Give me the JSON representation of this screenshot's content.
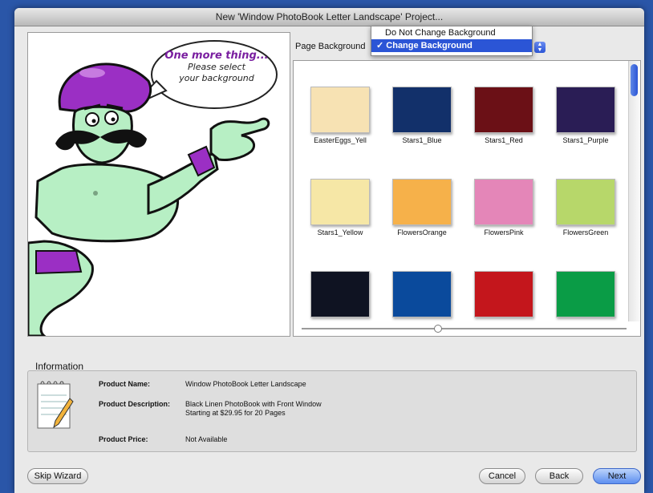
{
  "window": {
    "title": "New 'Window PhotoBook Letter Landscape' Project..."
  },
  "bubble": {
    "title": "One more thing...",
    "line1": "Please select",
    "line2": "your background"
  },
  "page_background": {
    "label": "Page Background",
    "options": [
      "Do Not Change Background",
      "Change Background"
    ],
    "selected": "Change Background",
    "check": "✓"
  },
  "backgrounds": [
    {
      "label": "EasterEggs_Yell",
      "color": "#f7e2b3"
    },
    {
      "label": "Stars1_Blue",
      "color": "#12306a"
    },
    {
      "label": "Stars1_Red",
      "color": "#6b1016"
    },
    {
      "label": "Stars1_Purple",
      "color": "#2a1d55"
    },
    {
      "label": "Stars1_Yellow",
      "color": "#f6e7a6"
    },
    {
      "label": "FlowersOrange",
      "color": "#f6b14a"
    },
    {
      "label": "FlowersPink",
      "color": "#e486b8"
    },
    {
      "label": "FlowersGreen",
      "color": "#b7d76a"
    },
    {
      "label": "",
      "color": "#0f1322"
    },
    {
      "label": "",
      "color": "#0a4a9c"
    },
    {
      "label": "",
      "color": "#c4161c"
    },
    {
      "label": "",
      "color": "#0a9c46"
    }
  ],
  "information": {
    "heading": "Information",
    "product_name_label": "Product Name:",
    "product_name": "Window PhotoBook Letter Landscape",
    "product_description_label": "Product Description:",
    "product_description_line1": "Black Linen PhotoBook with Front Window",
    "product_description_line2": "Starting at $29.95 for 20 Pages",
    "product_price_label": "Product Price:",
    "product_price": "Not Available"
  },
  "buttons": {
    "skip": "Skip Wizard",
    "cancel": "Cancel",
    "back": "Back",
    "next": "Next"
  }
}
